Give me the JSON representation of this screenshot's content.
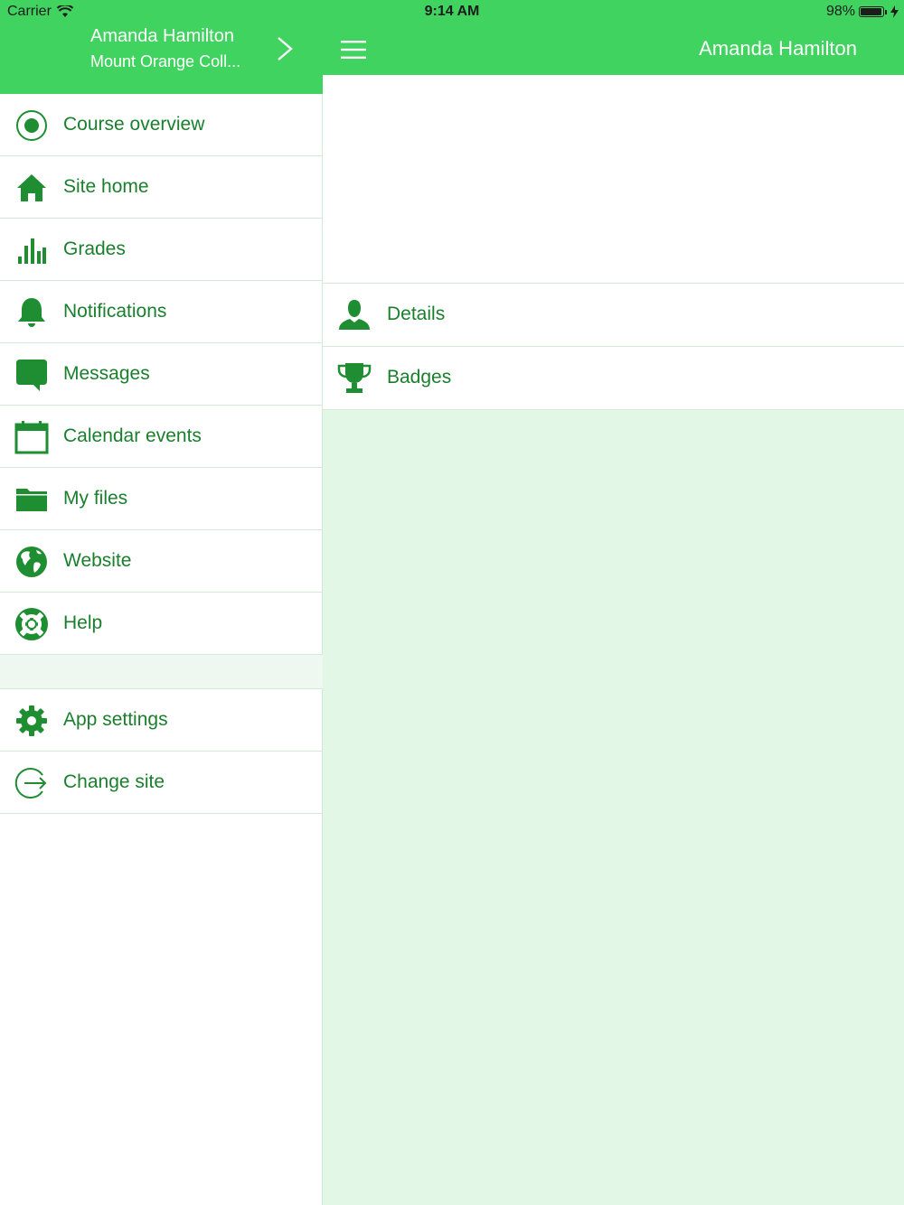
{
  "status_bar": {
    "carrier": "Carrier",
    "time": "9:14 AM",
    "battery_text": "98%",
    "battery_level": 0.98
  },
  "side_menu": {
    "user_name": "Amanda Hamilton",
    "site_name": "Mount Orange Coll...",
    "items": [
      {
        "label": "Course overview",
        "icon": "course-overview-icon"
      },
      {
        "label": "Site home",
        "icon": "home-icon"
      },
      {
        "label": "Grades",
        "icon": "grades-chart-icon"
      },
      {
        "label": "Notifications",
        "icon": "bell-icon"
      },
      {
        "label": "Messages",
        "icon": "chat-bubble-icon"
      },
      {
        "label": "Calendar events",
        "icon": "calendar-icon"
      },
      {
        "label": "My files",
        "icon": "folder-icon"
      },
      {
        "label": "Website",
        "icon": "globe-icon"
      },
      {
        "label": "Help",
        "icon": "lifebuoy-icon"
      }
    ],
    "footer_items": [
      {
        "label": "App settings",
        "icon": "gear-icon"
      },
      {
        "label": "Change site",
        "icon": "logout-icon"
      }
    ]
  },
  "main": {
    "title": "Amanda Hamilton",
    "items": [
      {
        "label": "Details",
        "icon": "person-icon"
      },
      {
        "label": "Badges",
        "icon": "trophy-icon"
      }
    ]
  },
  "colors": {
    "primary": "#41d35f",
    "text_green": "#1a7f2c",
    "icon_green": "#1f8e33",
    "main_bg": "#e2f7e5"
  }
}
